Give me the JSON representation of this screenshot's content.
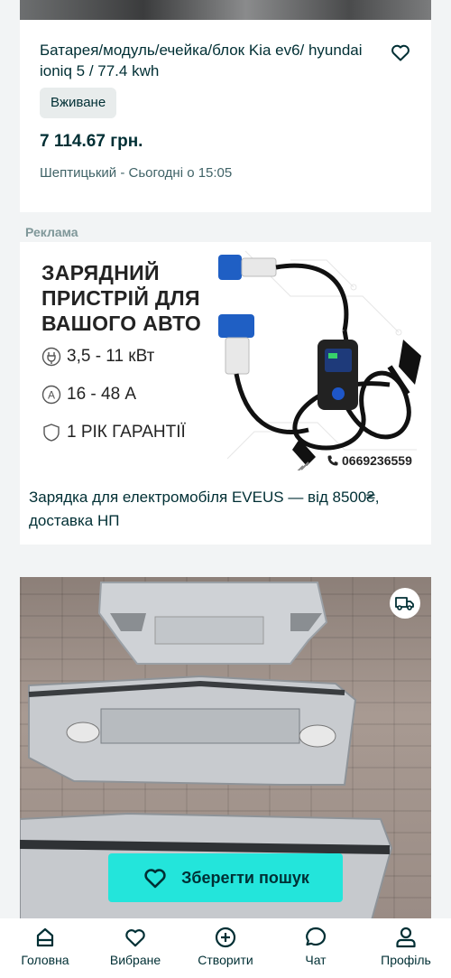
{
  "listing_top": {
    "title": "Батарея/модуль/ечейка/блок Kia ev6/ hyundai ioniq 5 / 77.4 kwh",
    "condition": "Вживане",
    "price": "7 114.67 грн.",
    "location_date": "Шептицький - Сьогодні о 15:05"
  },
  "ad": {
    "label": "Реклама",
    "banner_heading_1": "ЗАРЯДНИЙ",
    "banner_heading_2": "ПРИСТРІЙ ДЛЯ",
    "banner_heading_3": "ВАШОГО АВТО",
    "spec_power": "3,5 - 11 кВт",
    "spec_current": "16 - 48 А",
    "spec_warranty": "1 РІК ГАРАНТІЇ",
    "phone": "0669236559",
    "text": "Зарядка для електромобіля EVEUS — від 8500₴, доставка НП"
  },
  "listing_bottom": {
    "save_search_label": "Зберегти пошук"
  },
  "nav": {
    "home": "Головна",
    "favorites": "Вибране",
    "create": "Створити",
    "chat": "Чат",
    "profile": "Профіль"
  },
  "colors": {
    "primary_text": "#002f34",
    "accent": "#23e5db",
    "muted": "#406367"
  }
}
